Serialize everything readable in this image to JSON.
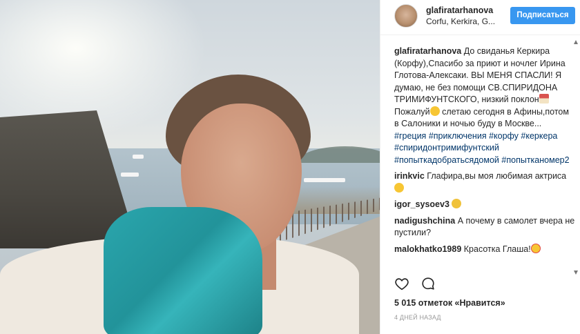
{
  "header": {
    "username": "glafiratarhanova",
    "location": "Corfu, Kerkira, G...",
    "follow_label": "Подписаться"
  },
  "caption": {
    "username": "glafiratarhanova",
    "text": "До свиданья Керкира (Корфу),Спасибо за приют и ночлег Ирина Глотова-Алексаки. ВЫ МЕНЯ СПАСЛИ! Я думаю, не без помощи СВ.СПИРИДОНА ТРИМИФУНТСКОГО, низкий поклон",
    "text2": "Пожалуй",
    "text3": " слетаю сегодня в Афины,потом в Салоники и ночью буду в Москве...",
    "hashtags": [
      "#греция",
      "#приключения",
      "#корфу",
      "#керкера",
      "#спиридонтримифунтский",
      "#попыткадобратьсядомой",
      "#попытканомер2"
    ]
  },
  "comments": [
    {
      "username": "irinkvic",
      "text": "Глафира,вы моя любимая актриса",
      "emoji": "smile"
    },
    {
      "username": "igor_sysoev3",
      "text": "",
      "emoji": "grin"
    },
    {
      "username": "nadigushchina",
      "text": "А почему в самолет вчера не пустили?",
      "emoji": ""
    },
    {
      "username": "malokhatko1989",
      "text": "Красотка Глаша!",
      "emoji": "hearts"
    }
  ],
  "likes": "5 015 отметок «Нравится»",
  "timestamp": "4 ДНЕЙ НАЗАД",
  "colors": {
    "accent": "#3897f0",
    "hashtag": "#003569",
    "text": "#262626",
    "muted": "#999999"
  },
  "icons": {
    "like": "heart-icon",
    "comment": "comment-icon"
  }
}
